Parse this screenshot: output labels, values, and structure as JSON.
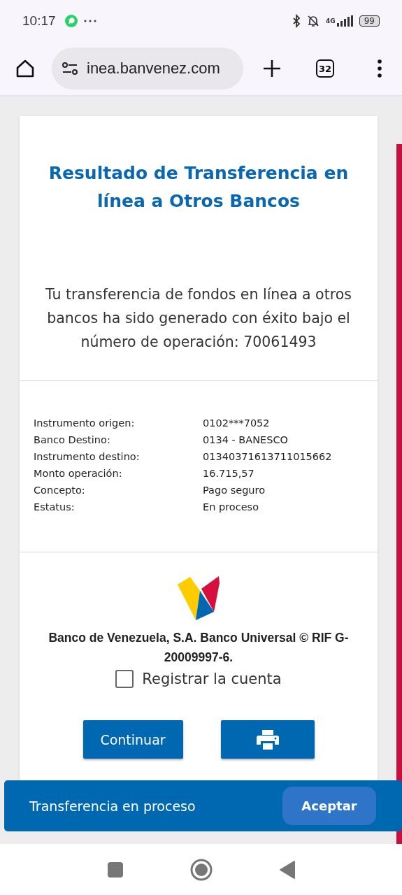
{
  "status_bar": {
    "time": "10:17",
    "network": "4G",
    "battery": "99"
  },
  "browser": {
    "url": "inea.banvenez.com",
    "tab_count": "32"
  },
  "page": {
    "title": "Resultado de Transferencia en línea a Otros Bancos",
    "message": "Tu transferencia de fondos en línea a otros bancos ha sido generado con éxito bajo el número de operación: 70061493",
    "details": [
      {
        "label": "Instrumento origen:",
        "value": "0102***7052"
      },
      {
        "label": "Banco Destino:",
        "value": "0134 - BANESCO"
      },
      {
        "label": "Instrumento destino:",
        "value": "01340371613711015662"
      },
      {
        "label": "Monto operación:",
        "value": "16.715,57"
      },
      {
        "label": "Concepto:",
        "value": "Pago seguro"
      },
      {
        "label": "Estatus:",
        "value": "En proceso"
      }
    ],
    "footer": "Banco de Venezuela, S.A. Banco Universal © RIF G-20009997-6.",
    "register": {
      "label": "Registrar la cuenta",
      "checked": false
    },
    "buttons": [
      {
        "kind": "text",
        "label": "Continuar"
      },
      {
        "kind": "print"
      }
    ]
  },
  "snackbar": {
    "message": "Transferencia en proceso",
    "action": "Aceptar"
  }
}
